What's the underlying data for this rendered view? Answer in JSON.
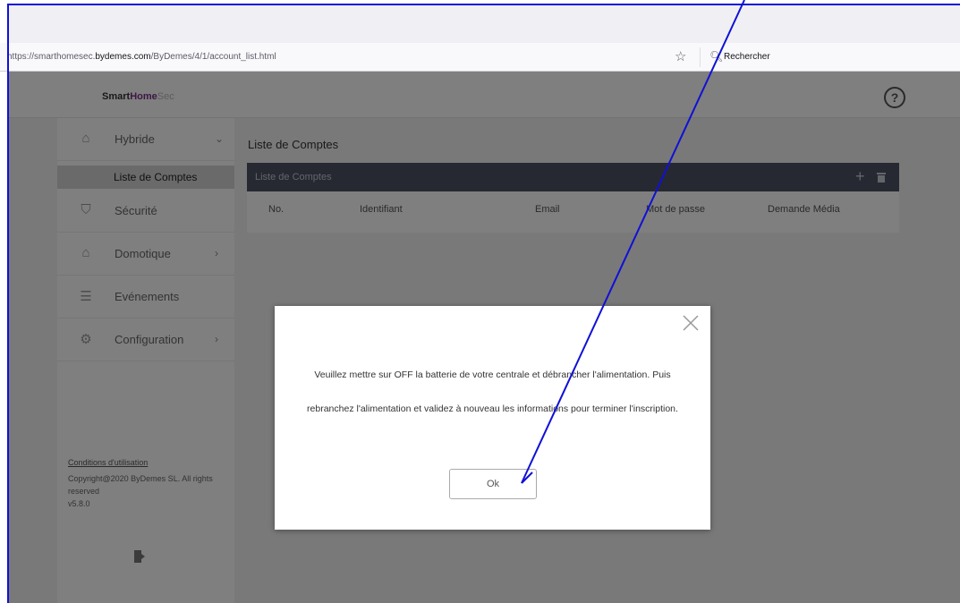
{
  "browser": {
    "url_prefix": "https://smarthomesec.",
    "url_domain": "bydemes.com",
    "url_path": "/ByDemes/4/1/account_list.html",
    "search_placeholder": "Rechercher"
  },
  "app": {
    "logo_smart": "Smart",
    "logo_home": "Home",
    "logo_sec": "Sec",
    "help_label": "?"
  },
  "sidebar": {
    "items": [
      {
        "label": "Hybride",
        "icon": "house-person-icon",
        "arrow": "⌄"
      },
      {
        "label": "Sécurité",
        "icon": "shield-icon"
      },
      {
        "label": "Domotique",
        "icon": "smart-home-icon",
        "arrow": "›"
      },
      {
        "label": "Evénements",
        "icon": "list-icon"
      },
      {
        "label": "Configuration",
        "icon": "gear-icon",
        "arrow": "›"
      }
    ],
    "subitem": "Liste de Comptes",
    "footer_link": "Conditions d'utilisation",
    "copyright": "Copyright@2020 ByDemes SL. All rights reserved",
    "version": "v5.8.0"
  },
  "content": {
    "title": "Liste de Comptes",
    "card_title": "Liste de Comptes",
    "columns": [
      "No.",
      "Identifiant",
      "Email",
      "Mot de passe",
      "Demande Média"
    ]
  },
  "modal": {
    "message": "Veuillez mettre sur OFF la batterie de votre centrale et débrancher l'alimentation. Puis rebranchez l'alimentation et validez à nouveau les informations pour terminer l'inscription.",
    "ok_label": "Ok"
  },
  "colors": {
    "annotation_line": "#1010d8",
    "card_header": "#4d5263",
    "brand_purple": "#7a2d8c"
  }
}
